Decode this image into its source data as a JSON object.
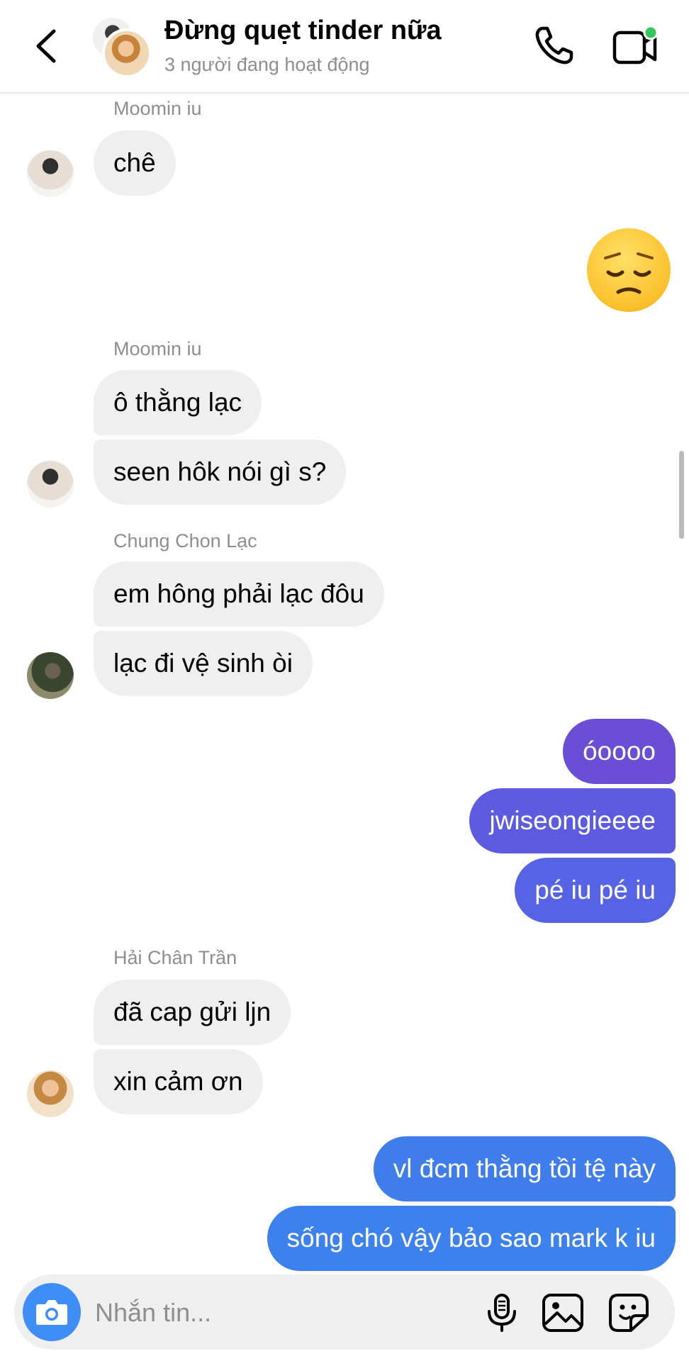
{
  "header": {
    "title": "Đừng quẹt tinder nữa",
    "subtitle": "3 người đang hoạt động"
  },
  "composer": {
    "placeholder": "Nhắn tin..."
  },
  "messages": [
    {
      "sender": "Moomin iu",
      "text": "chê"
    },
    {
      "emoji": "pensive-face"
    },
    {
      "sender": "Moomin iu",
      "text": "ô thằng lạc"
    },
    {
      "text": "seen hôk nói gì s?"
    },
    {
      "sender": "Chung Chon Lạc",
      "text": "em hông phải lạc đôu"
    },
    {
      "text": "lạc đi vệ sinh òi"
    },
    {
      "text": "óoooo"
    },
    {
      "text": "jwiseongieeee"
    },
    {
      "text": "pé iu pé iu"
    },
    {
      "sender": "Hải Chân Trần",
      "text": "đã cap gửi ljn"
    },
    {
      "text": "xin cảm ơn"
    },
    {
      "text": "vl đcm thằng tồi tệ này"
    },
    {
      "text": "sống chó vậy bảo sao mark k iu"
    }
  ],
  "colors": {
    "incoming_bubble": "#efefef",
    "outgoing_top": "#6a4fd6",
    "outgoing_bottom": "#3d82ec",
    "active_dot": "#35c759"
  }
}
